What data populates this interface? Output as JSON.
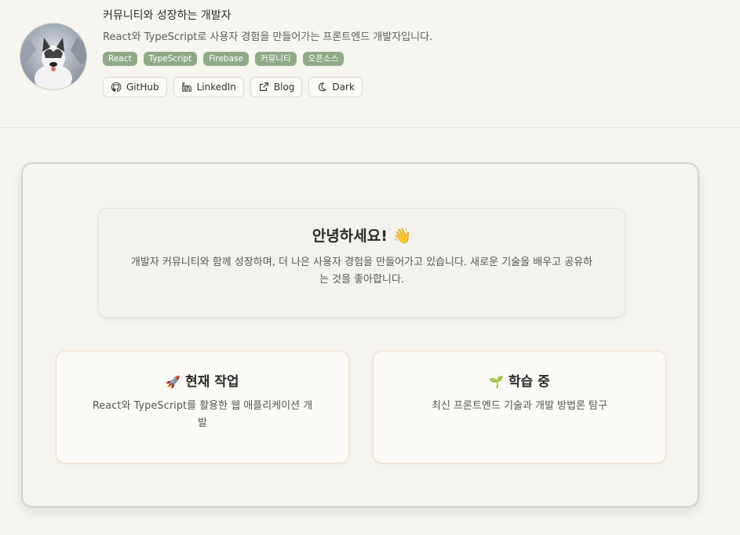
{
  "profile": {
    "title": "커뮤니티와 성장하는 개발자",
    "subtitle": "React와 TypeScript로 사용자 경험을 만들어가는 프론트엔드 개발자입니다.",
    "avatar_icon": "dog-photo-avatar",
    "tags": [
      "React",
      "TypeScript",
      "Firebase",
      "커뮤니티",
      "오픈소스"
    ],
    "tag_color": "#8faa86",
    "buttons": [
      {
        "label": "GitHub",
        "icon": "github-icon"
      },
      {
        "label": "LinkedIn",
        "icon": "linkedin-icon"
      },
      {
        "label": "Blog",
        "icon": "external-link-icon"
      },
      {
        "label": "Dark",
        "icon": "moon-icon"
      }
    ]
  },
  "intro": {
    "heading": "안녕하세요! 👋",
    "body": "개발자 커뮤니티와 함께 성장하며, 더 나은 사용자 경험을 만들어가고 있습니다. 새로운 기술을 배우고 공유하는 것을 좋아합니다."
  },
  "cards": [
    {
      "emoji": "🚀",
      "title": "현재 작업",
      "body": "React와 TypeScript를 활용한 웹 애플리케이션 개발"
    },
    {
      "emoji": "🌱",
      "title": "학습 중",
      "body": "최신 프론트엔드 기술과 개발 방법론 탐구"
    }
  ]
}
